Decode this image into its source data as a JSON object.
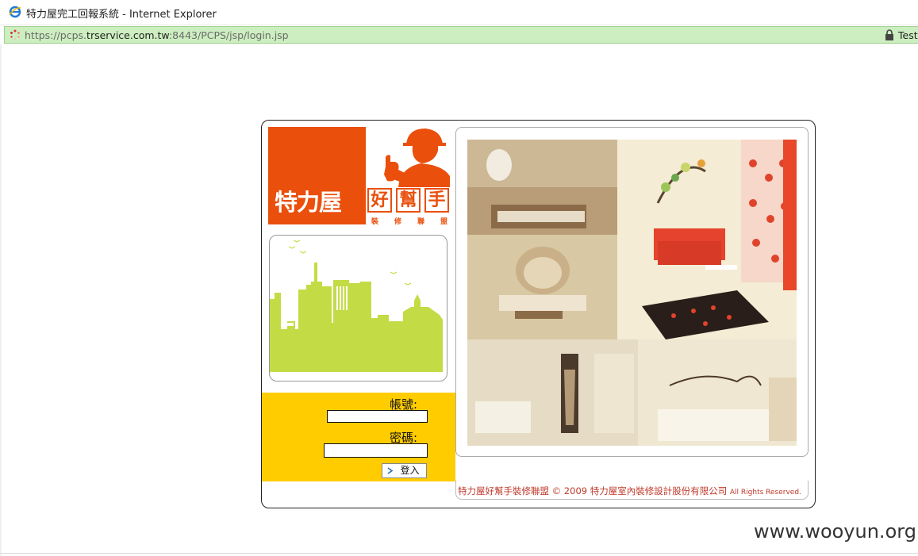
{
  "window": {
    "title": "特力屋完工回報系統 - Internet Explorer",
    "url_scheme_host": "https://pcps.",
    "url_domain": "trservice.com.tw",
    "url_path": ":8443/PCPS/jsp/login.jsp",
    "cert_label": "Test"
  },
  "logo": {
    "brand": "特力屋",
    "boxes": [
      "好",
      "幫",
      "手"
    ],
    "sub": [
      "裝",
      "修",
      "聯",
      "盟"
    ]
  },
  "login": {
    "account_label": "帳號:",
    "account_value": "",
    "password_label": "密碼:",
    "password_value": "",
    "submit_label": "登入"
  },
  "footer": {
    "text": "特力屋好幫手裝修聯盟 © 2009 特力屋室內裝修設計股份有限公司",
    "rights": "All Rights Reserved."
  },
  "watermark": "www.wooyun.org",
  "colors": {
    "brand_orange": "#ea4f0c",
    "login_bg": "#ffcc00",
    "city_green": "#c3dc45",
    "address_bar": "#cdeec0"
  },
  "icons": [
    "ie-icon",
    "loading-icon",
    "lock-icon",
    "arrow-icon"
  ]
}
